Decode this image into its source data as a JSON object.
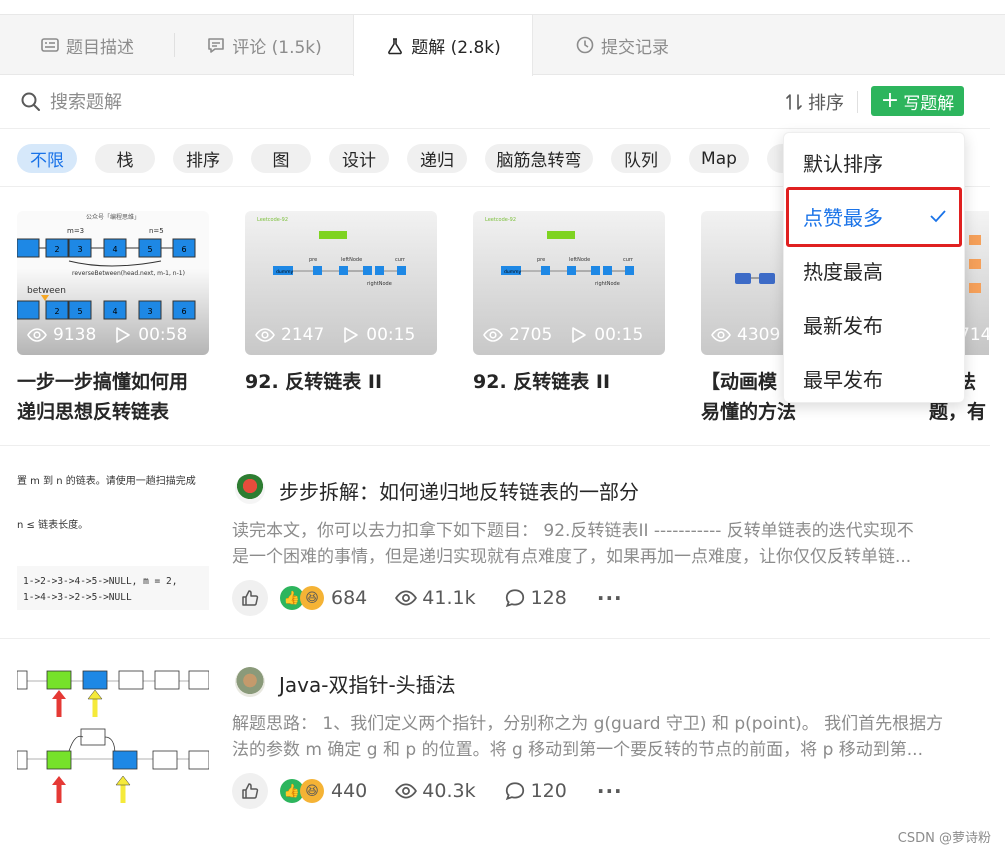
{
  "tabs": [
    {
      "label": "题目描述",
      "icon": "description-icon"
    },
    {
      "label": "评论 (1.5k)",
      "icon": "comment-icon"
    },
    {
      "label": "题解 (2.8k)",
      "icon": "flask-icon"
    },
    {
      "label": "提交记录",
      "icon": "clock-icon"
    }
  ],
  "search": {
    "placeholder": "搜索题解"
  },
  "toolbar": {
    "sort_label": "排序",
    "write_label": "写题解"
  },
  "tags": [
    "不限",
    "栈",
    "排序",
    "图",
    "设计",
    "递归",
    "脑筋急转弯",
    "队列",
    "Map"
  ],
  "video_cards": [
    {
      "views": "9138",
      "duration": "00:58",
      "title_line1": "一步一步搞懂如何用",
      "title_line2": "递归思想反转链表"
    },
    {
      "views": "2147",
      "duration": "00:15",
      "title_line1": "92. 反转链表 II",
      "title_line2": ""
    },
    {
      "views": "2705",
      "duration": "00:15",
      "title_line1": "92. 反转链表 II",
      "title_line2": ""
    },
    {
      "views": "4309",
      "duration": "",
      "title_line1": "【动画模",
      "title_line2": "易懂的方法"
    },
    {
      "views": "714",
      "duration": "",
      "title_line1": "法",
      "title_line2": "题，有"
    }
  ],
  "thumb_texts": {
    "card1_top": "公众号「编程思维」",
    "card1_mid": "reverseBetween(head.next, m-1, n-1)",
    "card1_between": "between",
    "card1_m": "m=3",
    "card1_n": "n=5",
    "card2_label": "Leetcode-92",
    "card2_pre": "pre",
    "card2_left": "leftNode",
    "card2_right": "rightNode",
    "card2_curr": "curr",
    "card2_dummy": "dummy",
    "art1_line1": "置 m 到 n 的链表。请使用一趟扫描完成",
    "art1_line2": "n ≤ 链表长度。",
    "art1_code1": "1->2->3->4->5->NULL, m = 2,",
    "art1_code2": "1->4->3->2->5->NULL"
  },
  "sort_menu": {
    "items": [
      "默认排序",
      "点赞最多",
      "热度最高",
      "最新发布",
      "最早发布"
    ],
    "selected": "点赞最多"
  },
  "articles": [
    {
      "title": "步步拆解：如何递归地反转链表的一部分",
      "summary_line1": "读完本文，你可以去力扣拿下如下题目： 92.反转链表II ----------- 反转单链表的迭代实现不",
      "summary_line2": "是一个困难的事情，但是递归实现就有点难度了，如果再加一点难度，让你仅仅反转单链...",
      "reactions": "684",
      "views": "41.1k",
      "comments": "128"
    },
    {
      "title": "Java-双指针-头插法",
      "summary_line1": "解题思路： 1、我们定义两个指针，分别称之为 g(guard 守卫) 和 p(point)。 我们首先根据方",
      "summary_line2": "法的参数 m 确定 g 和 p 的位置。将 g 移动到第一个要反转的节点的前面，将 p 移动到第...",
      "reactions": "440",
      "views": "40.3k",
      "comments": "120"
    }
  ],
  "watermark": "CSDN @萝诗粉",
  "colors": {
    "accent": "#1a73e8",
    "green": "#2db55d",
    "highlight": "#e02020",
    "node_blue": "#1e88e5"
  }
}
